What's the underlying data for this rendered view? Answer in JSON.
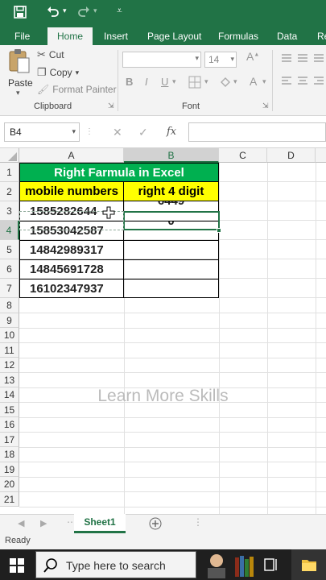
{
  "ribbon_tabs": [
    "File",
    "Home",
    "Insert",
    "Page Layout",
    "Formulas",
    "Data",
    "Re"
  ],
  "clipboard": {
    "paste": "Paste",
    "cut": "Cut",
    "copy": "Copy",
    "format_painter": "Format Painter",
    "group_label": "Clipboard"
  },
  "font": {
    "size": "14",
    "bold": "B",
    "italic": "I",
    "underline": "U",
    "font_color_letter": "A",
    "group_label": "Font"
  },
  "formula_bar": {
    "name_box": "B4",
    "fx": "fx"
  },
  "columns": [
    "A",
    "B",
    "C",
    "D"
  ],
  "rows": [
    "1",
    "2",
    "3",
    "4",
    "5",
    "6",
    "7",
    "8",
    "9",
    "10",
    "11",
    "12",
    "13",
    "14",
    "15",
    "16",
    "17",
    "18",
    "19",
    "20",
    "21"
  ],
  "sheet": {
    "title": "Right Farmula in Excel",
    "header_a": "mobile numbers",
    "header_b": "right 4 digit",
    "numbers": [
      "1585282644",
      "15853042587",
      "14842989317",
      "14845691728",
      "16102347937"
    ],
    "b3_partial": "6449",
    "b4_partial": "0"
  },
  "sheet_tab": "Sheet1",
  "status": "Ready",
  "watermark": "Learn More Skills",
  "taskbar": {
    "search_placeholder": "Type here to search"
  },
  "colors": {
    "excel_green": "#217346",
    "title_fill": "#00b050",
    "header_fill": "#ffff00"
  }
}
